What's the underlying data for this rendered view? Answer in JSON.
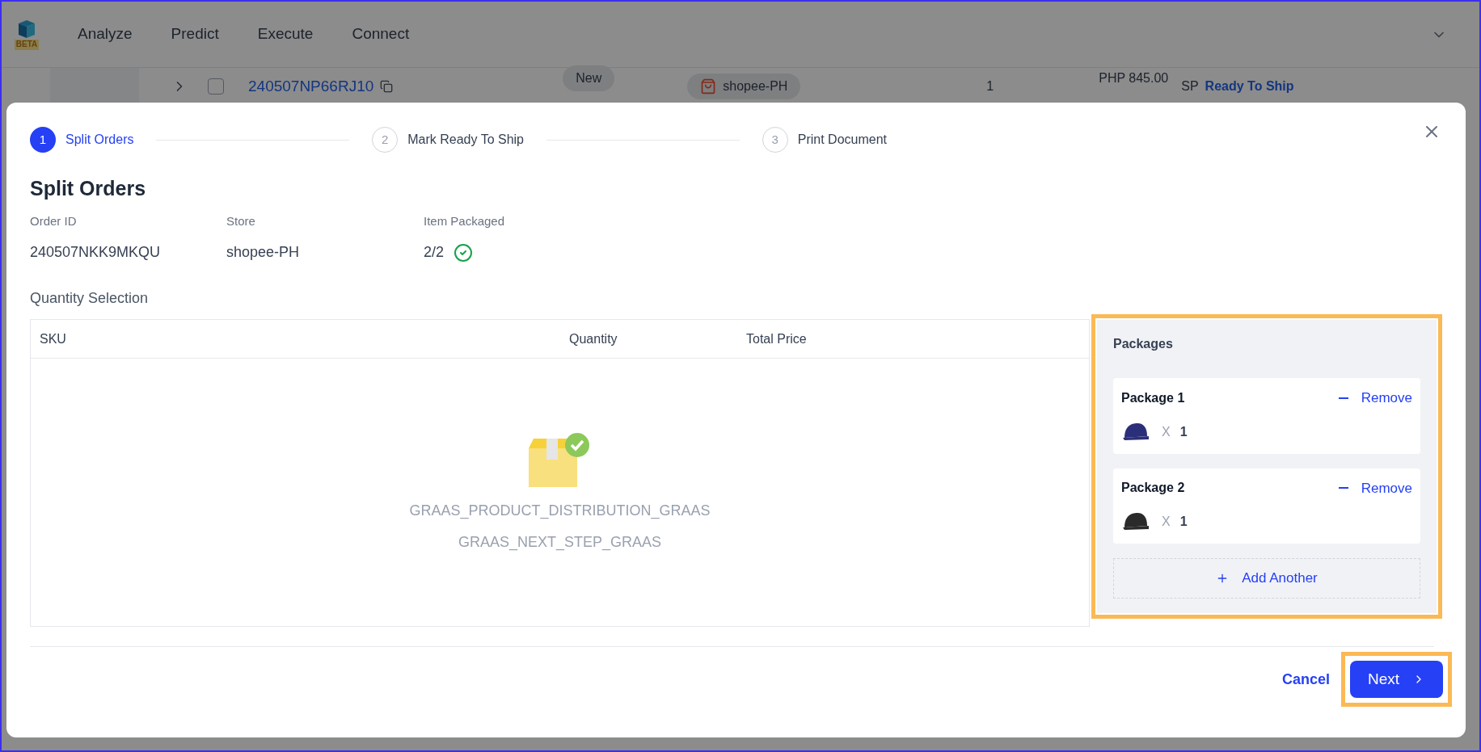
{
  "nav": {
    "beta_badge": "BETA",
    "menu": [
      {
        "label": "Analyze"
      },
      {
        "label": "Predict"
      },
      {
        "label": "Execute"
      },
      {
        "label": "Connect"
      }
    ]
  },
  "background_row": {
    "order_id": "240507NP66RJ10",
    "checked": false,
    "status_tag": "New",
    "store": "shopee-PH",
    "quantity": "1",
    "price": "PHP 845.00",
    "column_6": "SP",
    "action": "Ready To Ship"
  },
  "modal": {
    "steps": [
      {
        "number": "1",
        "label": "Split Orders",
        "selected": true
      },
      {
        "number": "2",
        "label": "Mark Ready To Ship",
        "selected": false
      },
      {
        "number": "3",
        "label": "Print Document",
        "selected": false
      }
    ],
    "title": "Split Orders",
    "fields": [
      {
        "label": "Order ID",
        "value": "240507NKK9MKQU"
      },
      {
        "label": "Store",
        "value": "shopee-PH"
      },
      {
        "label": "Item Packaged",
        "value": "2/2",
        "complete": true
      }
    ],
    "section_title": "Quantity Selection",
    "table": {
      "columns": [
        "SKU",
        "Quantity",
        "Total Price"
      ],
      "empty_lines": [
        "GRAAS_PRODUCT_DISTRIBUTION_GRAAS",
        "GRAAS_NEXT_STEP_GRAAS"
      ]
    },
    "packages": {
      "title": "Packages",
      "items": [
        {
          "name": "Package 1",
          "remove": "Remove",
          "multiply": "X",
          "quantity": "1",
          "color": "#2b2f7a"
        },
        {
          "name": "Package 2",
          "remove": "Remove",
          "multiply": "X",
          "quantity": "1",
          "color": "#2a2a2a"
        }
      ],
      "add": "Add Another"
    },
    "buttons": {
      "cancel": "Cancel",
      "next": "Next"
    }
  }
}
